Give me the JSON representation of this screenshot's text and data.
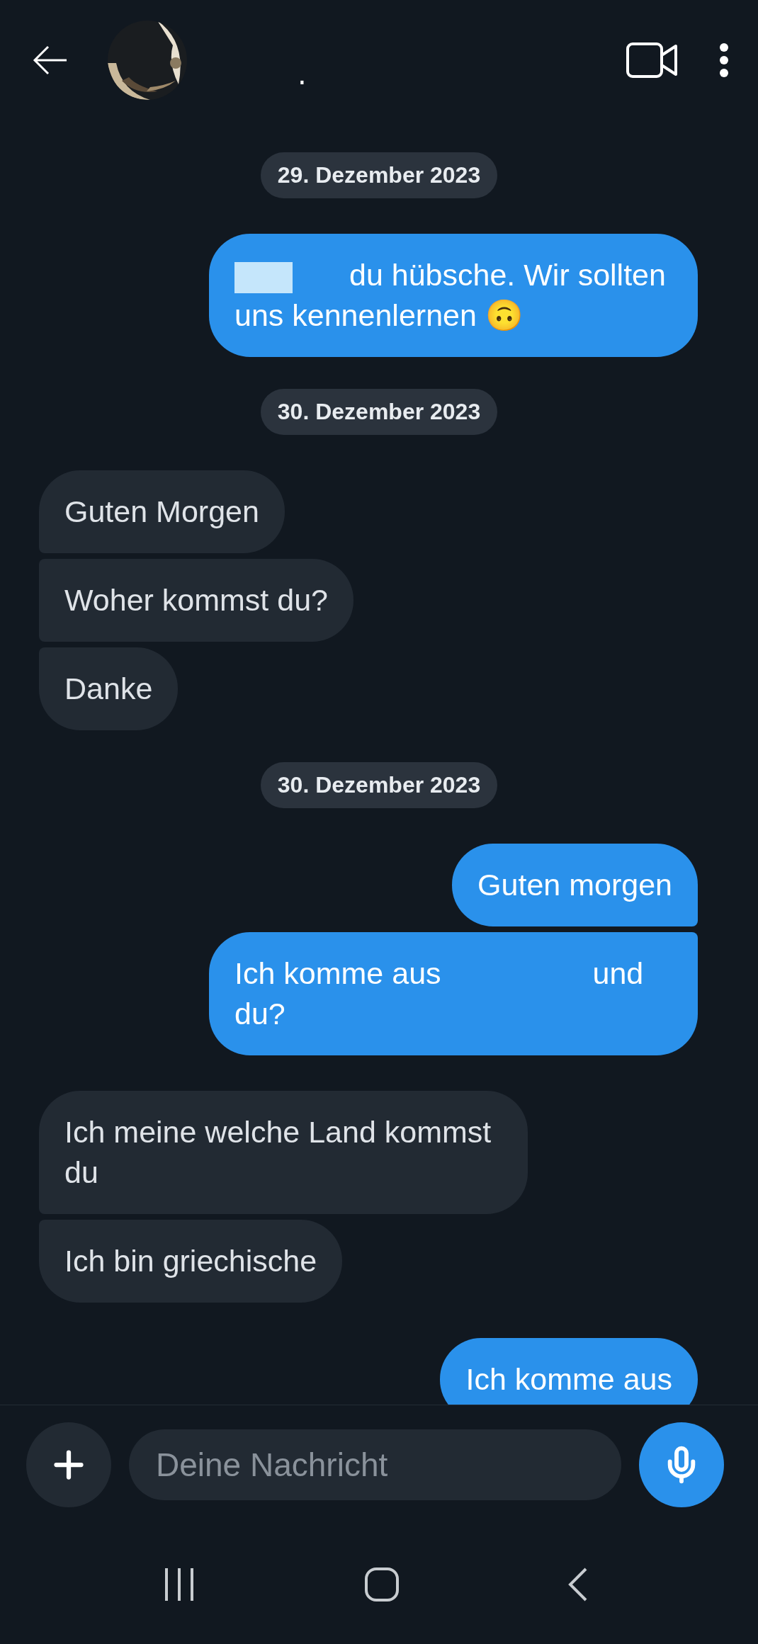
{
  "header": {
    "name": "."
  },
  "messages": [
    {
      "kind": "date",
      "text": "29. Dezember 2023"
    },
    {
      "kind": "outgoing",
      "segments": [
        {
          "kind": "redaction"
        },
        {
          "kind": "text",
          "text": "du hübsche. Wir sollten uns kennenlernen 🙃"
        }
      ]
    },
    {
      "kind": "date",
      "text": "30. Dezember 2023"
    },
    {
      "kind": "incoming",
      "segments": [
        {
          "kind": "text",
          "text": "Guten Morgen"
        }
      ]
    },
    {
      "kind": "incoming",
      "segments": [
        {
          "kind": "text",
          "text": "Woher kommst du?"
        }
      ]
    },
    {
      "kind": "incoming",
      "segments": [
        {
          "kind": "text",
          "text": "Danke"
        }
      ]
    },
    {
      "kind": "date",
      "text": "30. Dezember 2023"
    },
    {
      "kind": "outgoing",
      "segments": [
        {
          "kind": "text",
          "text": "Guten morgen"
        }
      ]
    },
    {
      "kind": "outgoing",
      "segments": [
        {
          "kind": "text",
          "text": "Ich komme aus"
        },
        {
          "kind": "redaction"
        },
        {
          "kind": "text",
          "text": "und du?"
        }
      ]
    },
    {
      "kind": "incoming",
      "segments": [
        {
          "kind": "text",
          "text": "Ich meine welche Land kommst du"
        }
      ]
    },
    {
      "kind": "incoming",
      "segments": [
        {
          "kind": "text",
          "text": "Ich bin griechische"
        }
      ]
    },
    {
      "kind": "outgoing",
      "segments": [
        {
          "kind": "text",
          "text": "Ich komme aus"
        }
      ]
    }
  ],
  "composer": {
    "placeholder": "Deine Nachricht"
  }
}
